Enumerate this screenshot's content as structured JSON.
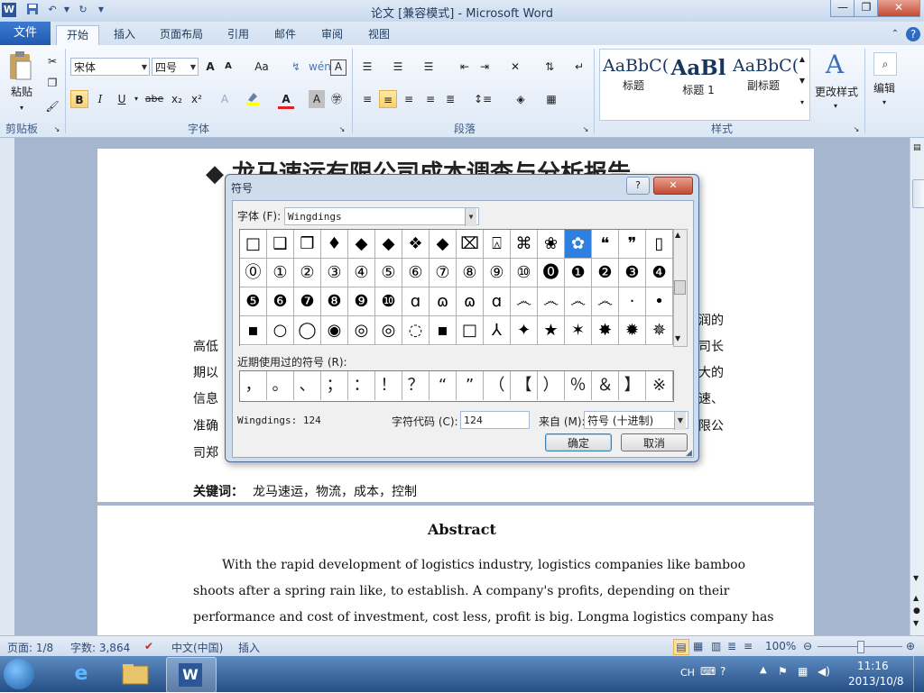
{
  "window": {
    "title": "论文 [兼容模式] - Microsoft Word",
    "app_icon": "W",
    "controls": {
      "minimize": "—",
      "maximize": "❐",
      "close": "✕"
    }
  },
  "tabs": {
    "file": "文件",
    "items": [
      "开始",
      "插入",
      "页面布局",
      "引用",
      "邮件",
      "审阅",
      "视图"
    ],
    "active": "开始"
  },
  "ribbon": {
    "clipboard": {
      "paste": "粘贴",
      "label": "剪贴板"
    },
    "font": {
      "name": "宋体",
      "size": "四号",
      "label": "字体",
      "grow": "A",
      "shrink": "A",
      "change_case": "Aa",
      "clear": "A",
      "bold": "B",
      "italic": "I",
      "underline": "U",
      "strike": "abe",
      "sub": "x₂",
      "sup": "x²",
      "color_a": "A",
      "char_border": "A"
    },
    "paragraph": {
      "label": "段落"
    },
    "styles": {
      "label": "样式",
      "items": [
        {
          "sample": "AaBbC(",
          "name": "标题"
        },
        {
          "sample": "AaBl",
          "name": "标题 1"
        },
        {
          "sample": "AaBbC(",
          "name": "副标题"
        }
      ],
      "change": "更改样式"
    },
    "edit": {
      "label": "编辑"
    }
  },
  "document": {
    "heading_visible": "◆ 龙马速运有限公司成本调查与分析报告",
    "body_left_chars": [
      "高低",
      "期以",
      "信息",
      "准确",
      "司郑"
    ],
    "body_right_chars": [
      "润的",
      "司长",
      "大的",
      "速、",
      "限公"
    ],
    "keywords_label": "关键词：",
    "keywords": "龙马速运，物流，成本，控制",
    "abstract_title": "Abstract",
    "abstract_lines": [
      "With the rapid development of logistics industry, logistics companies like bamboo",
      "shoots after a spring rain like, to establish. A company's profits, depending on their",
      "performance and cost of investment, cost less, profit is big. Longma logistics company has"
    ]
  },
  "dialog": {
    "title": "符号",
    "help": "?",
    "close": "✕",
    "font_label": "字体 (F):",
    "font_value": "Wingdings",
    "grid": [
      [
        "□",
        "❑",
        "❒",
        "♦",
        "◆",
        "◆",
        "❖",
        "◆",
        "⌧",
        "⍓",
        "⌘",
        "❀",
        "✿",
        "❝",
        "❞",
        "▯"
      ],
      [
        "⓪",
        "①",
        "②",
        "③",
        "④",
        "⑤",
        "⑥",
        "⑦",
        "⑧",
        "⑨",
        "⑩",
        "⓿",
        "❶",
        "❷",
        "❸",
        "❹"
      ],
      [
        "❺",
        "❻",
        "❼",
        "❽",
        "❾",
        "❿",
        "ɑ",
        "ɷ",
        "ɷ",
        "ɑ",
        "෴",
        "෴",
        "෴",
        "෴",
        "·",
        "•"
      ],
      [
        "▪",
        "○",
        "◯",
        "◉",
        "◎",
        "◎",
        "◌",
        "▪",
        "□",
        "⅄",
        "✦",
        "★",
        "✶",
        "✸",
        "✹",
        "✵"
      ]
    ],
    "selected": {
      "row": 0,
      "col": 12
    },
    "recent_label": "近期使用过的符号 (R):",
    "recent": [
      "，",
      "。",
      "、",
      "；",
      "：",
      "！",
      "？",
      "“",
      "”",
      "（",
      "【",
      "）",
      "％",
      "＆",
      "】",
      "※"
    ],
    "char_info": "Wingdings: 124",
    "code_label": "字符代码 (C):",
    "code_value": "124",
    "from_label": "来自 (M):",
    "from_value": "符号 (十进制)",
    "ok": "确定",
    "cancel": "取消"
  },
  "statusbar": {
    "page": "页面: 1/8",
    "words": "字数: 3,864",
    "lang": "中文(中国)",
    "mode": "插入",
    "zoom": "100%"
  },
  "taskbar": {
    "ime": "CH",
    "time": "11:16",
    "date": "2013/10/8"
  }
}
